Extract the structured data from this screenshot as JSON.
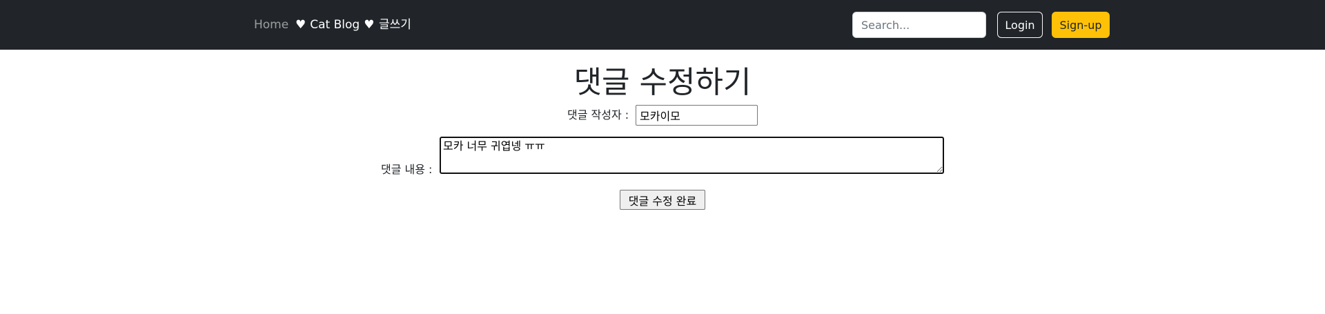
{
  "navbar": {
    "home_label": "Home",
    "brand_heart": "♥",
    "brand_label": "Cat Blog",
    "write_label": "글쓰기",
    "search_placeholder": "Search...",
    "login_label": "Login",
    "signup_label": "Sign-up",
    "colors": {
      "background": "#212529",
      "signup_accent": "#ffc107"
    }
  },
  "form": {
    "title": "댓글 수정하기",
    "author_label": "댓글 작성자 :",
    "author_value": "모카이모",
    "content_label": "댓글 내용 :",
    "content_value": "모카 너무 귀엽넹 ㅠㅠ",
    "submit_label": "댓글 수정 완료"
  }
}
